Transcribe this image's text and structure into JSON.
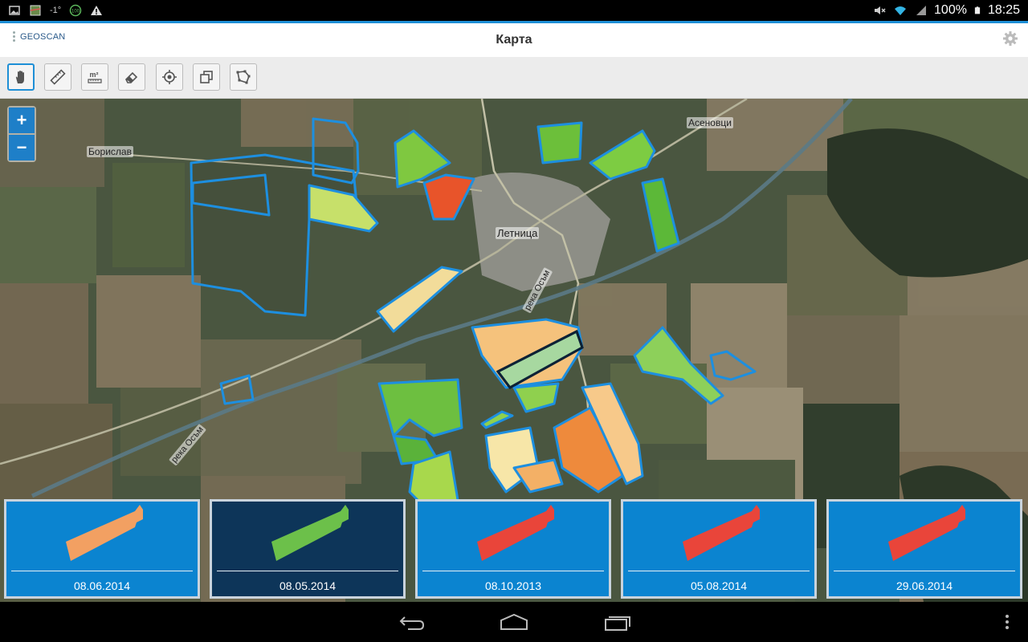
{
  "status_bar": {
    "left_icons": [
      "image-icon",
      "map-icon",
      "temperature-icon",
      "battery-badge-icon",
      "warning-icon"
    ],
    "temperature": "-1°",
    "badge": "100",
    "battery_percent": "100%",
    "time": "18:25"
  },
  "header": {
    "logo_text": "GEOSCAN",
    "title": "Карта",
    "settings_icon": "gear-icon"
  },
  "toolbar": {
    "tools": [
      {
        "name": "pan",
        "icon": "hand-icon",
        "active": true
      },
      {
        "name": "measure-distance",
        "icon": "ruler-icon",
        "active": false
      },
      {
        "name": "measure-area",
        "icon": "area-m2-icon",
        "label": "m²",
        "active": false
      },
      {
        "name": "erase",
        "icon": "eraser-icon",
        "active": false
      },
      {
        "name": "locate",
        "icon": "crosshair-icon",
        "active": false
      },
      {
        "name": "copy",
        "icon": "copy-icon",
        "active": false
      },
      {
        "name": "polygon",
        "icon": "polygon-icon",
        "active": false
      }
    ]
  },
  "map": {
    "zoom_in": "+",
    "zoom_out": "−",
    "places": {
      "borislav": "Борислав",
      "letnitsa": "Летница",
      "asenovtsi": "Асеновци",
      "river_1": "река Осъм",
      "river_2": "река Осъм"
    }
  },
  "dates": [
    {
      "date": "08.06.2014",
      "color": "#f2a062",
      "selected": false
    },
    {
      "date": "08.05.2014",
      "color": "#6cc04a",
      "selected": true
    },
    {
      "date": "08.10.2013",
      "color": "#e9453a",
      "selected": false
    },
    {
      "date": "05.08.2014",
      "color": "#e9453a",
      "selected": false
    },
    {
      "date": "29.06.2014",
      "color": "#e9453a",
      "selected": false
    }
  ],
  "colors": {
    "accent": "#1e8fd6",
    "card_bg": "#0b84d0",
    "card_selected": "#0d3559",
    "field_outline": "#1d8fe0"
  },
  "nav_bar": [
    "back-icon",
    "home-icon",
    "recent-apps-icon",
    "overflow-menu-icon"
  ]
}
